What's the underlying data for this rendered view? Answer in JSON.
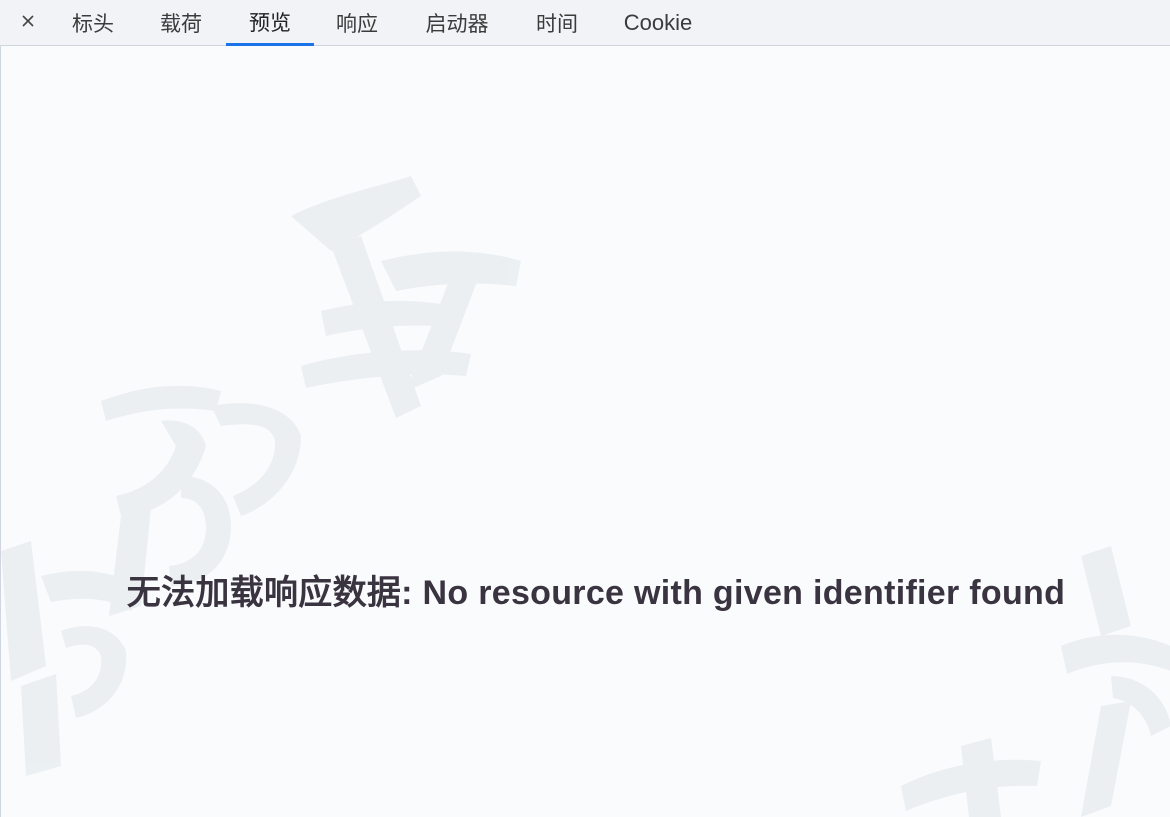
{
  "tabs": [
    {
      "label": "标头",
      "active": false
    },
    {
      "label": "载荷",
      "active": false
    },
    {
      "label": "预览",
      "active": true
    },
    {
      "label": "响应",
      "active": false
    },
    {
      "label": "启动器",
      "active": false
    },
    {
      "label": "时间",
      "active": false
    },
    {
      "label": "Cookie",
      "active": false
    }
  ],
  "close_icon": "close-icon",
  "preview": {
    "message": "无法加载响应数据: No resource with given identifier found"
  },
  "colors": {
    "active_tab_underline": "#1a73e8",
    "tabbar_background": "#f1f3f6",
    "content_background": "#f9fbfd",
    "message_text": "#3a3340"
  }
}
